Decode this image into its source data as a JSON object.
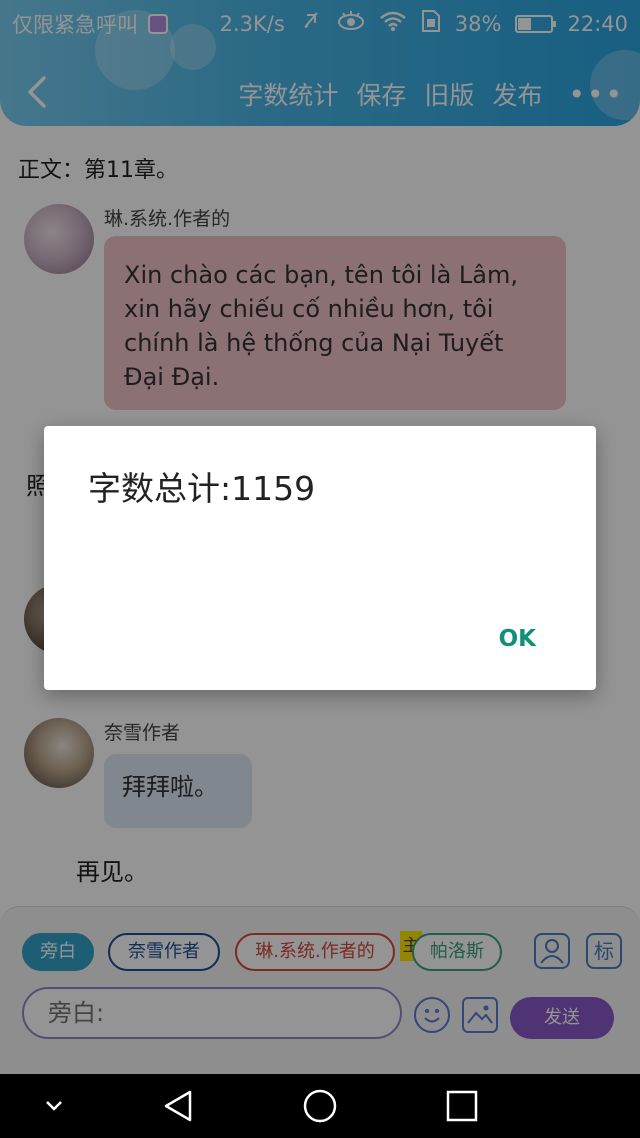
{
  "statusbar": {
    "left_text": "仅限紧急呼叫",
    "speed": "2.3K/s",
    "battery": "38%",
    "battery_level": 0.38,
    "time": "22:40",
    "icons": [
      "mute-icon",
      "eye-icon",
      "wifi-icon",
      "sim-icon",
      "battery-icon"
    ]
  },
  "nav": {
    "word_count": "字数统计",
    "save": "保存",
    "old_version": "旧版",
    "publish": "发布",
    "more": "•••"
  },
  "content": {
    "body_title": "正文：第11章。",
    "messages": [
      {
        "name": "琳.系统.作者的",
        "text": "Xin chào các bạn, tên tôi là Lâm, xin hãy chiếu cố nhiều hơn, tôi chính là hệ thống của Nại Tuyết Đại Đại."
      },
      {
        "name": "奈雪作者",
        "text": "拜拜啦。"
      }
    ],
    "narration_partial": "照",
    "narration_end": "再见。"
  },
  "input_area": {
    "chips": [
      "旁白",
      "奈雪作者",
      "琳.系统.作者的",
      "帕洛斯"
    ],
    "main_tag": "主",
    "placeholder": "旁白:",
    "side_icon": "标",
    "send": "发送"
  },
  "dialog": {
    "message": "字数总计:1159",
    "ok": "OK"
  },
  "colors": {
    "header": "#2aa4e0",
    "bubble_pink": "#f2c3c8",
    "bubble_blue": "#dfe9f4",
    "send": "#8a58c9",
    "ok": "#109078"
  }
}
